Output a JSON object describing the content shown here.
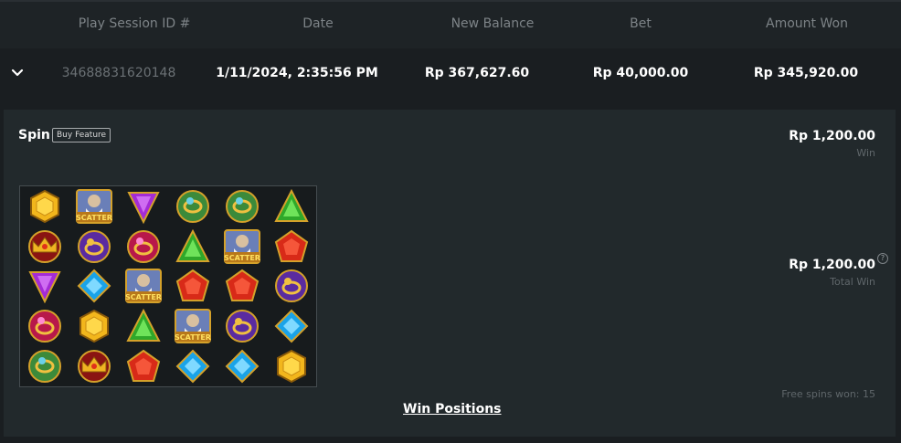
{
  "header": {
    "session_id": "Play Session ID #",
    "date": "Date",
    "new_balance": "New Balance",
    "bet": "Bet",
    "amount_won": "Amount Won"
  },
  "row": {
    "session_id": "34688831620148",
    "date": "1/11/2024, 2:35:56 PM",
    "new_balance": "Rp 367,627.60",
    "bet": "Rp 40,000.00",
    "amount_won": "Rp 345,920.00"
  },
  "spin": {
    "label": "Spin",
    "badge": "Buy Feature",
    "win_amount": "Rp 1,200.00",
    "win_label": "Win",
    "total_win_amount": "Rp 1,200.00",
    "total_win_label": "Total Win",
    "help": "?",
    "free_spins": "Free spins won: 15",
    "win_positions": "Win Positions",
    "scatter_text": "SCATTER"
  },
  "reels": [
    [
      "gem-yellow",
      "scatter",
      "gem-purple-triangle",
      "ring-green",
      "ring-green",
      "gem-green-triangle"
    ],
    [
      "crown-red",
      "ring-purple",
      "ring-red",
      "gem-green-triangle",
      "scatter",
      "gem-red-pentagon"
    ],
    [
      "gem-purple-triangle",
      "gem-blue-diamond",
      "scatter",
      "gem-red-pentagon",
      "gem-red-pentagon",
      "ring-purple"
    ],
    [
      "ring-red",
      "gem-yellow",
      "gem-green-triangle",
      "scatter",
      "ring-purple",
      "gem-blue-diamond"
    ],
    [
      "ring-green",
      "crown-red",
      "gem-red-pentagon",
      "gem-blue-diamond",
      "gem-blue-diamond",
      "gem-yellow"
    ]
  ],
  "colors": {
    "background": "#1a1e21",
    "panel": "#22292c",
    "header_text": "#7d8387",
    "muted_text": "#5f666a"
  }
}
